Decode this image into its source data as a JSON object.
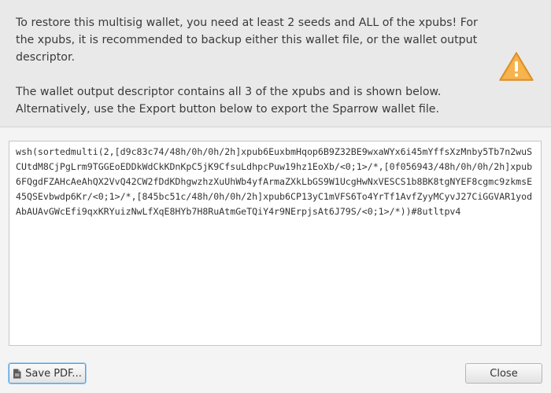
{
  "message": {
    "paragraph1": "To restore this multisig wallet, you need at least 2 seeds and ALL of the xpubs! For the xpubs, it is recommended to backup either this wallet file, or the wallet output descriptor.",
    "paragraph2": "The wallet output descriptor contains all 3 of the xpubs and is shown below. Alternatively, use the Export button below to export the Sparrow wallet file."
  },
  "descriptor": "wsh(sortedmulti(2,[d9c83c74/48h/0h/0h/2h]xpub6EuxbmHqop6B9Z32BE9wxaWYx6i45mYffsXzMnby5Tb7n2wuSCUtdM8CjPgLrm9TGGEoEDDkWdCkKDnKpC5jK9CfsuLdhpcPuw19hz1EoXb/<0;1>/*,[0f056943/48h/0h/0h/2h]xpub6FQgdFZAHcAeAhQX2VvQ42CW2fDdKDhgwzhzXuUhWb4yfArmaZXkLbGS9W1UcgHwNxVESCS1b8BK8tgNYEF8cgmc9zkmsE45QSEvbwdp6Kr/<0;1>/*,[845bc51c/48h/0h/0h/2h]xpub6CP13yC1mVFS6To4YrTf1AvfZyyMCyvJ27CiGGVAR1yodAbAUAvGWcEfi9qxKRYuizNwLfXqE8HYb7H8RuAtmGeTQiY4r9NErpjsAt6J79S/<0;1>/*))#8utltpv4",
  "buttons": {
    "save_pdf": "Save PDF...",
    "close": "Close"
  },
  "icons": {
    "warning": "warning-icon",
    "pdf": "pdf-file-icon"
  },
  "colors": {
    "warning_fill": "#f0a43a",
    "focus_border": "#5aa0d8"
  }
}
